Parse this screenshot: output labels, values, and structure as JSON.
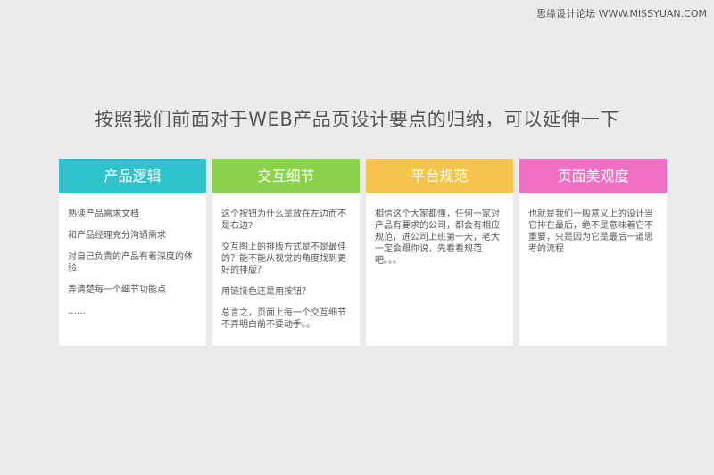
{
  "watermark": "思缘设计论坛 WWW.MISSYUAN.COM",
  "headline": "按照我们前面对于WEB产品页设计要点的归纳，可以延伸一下",
  "cards": [
    {
      "title": "产品逻辑",
      "color": "#2fc3cd",
      "lines": [
        "熟读产品需求文档",
        "和产品经理充分沟通需求",
        "对自己负责的产品有着深度的体验",
        "弄清楚每一个细节功能点",
        "……"
      ]
    },
    {
      "title": "交互细节",
      "color": "#8ad24a",
      "lines": [
        "这个按钮为什么是放在左边而不是右边?",
        "交互图上的排版方式是不是最佳的？能不能从视觉的角度找到更好的排版？",
        "用链接色还是用按钮？",
        "总言之，页面上每一个交互细节不弄明白前不要动手。。"
      ]
    },
    {
      "title": "平台规范",
      "color": "#f5c44c",
      "lines": [
        "相信这个大家都懂，任何一家对产品有要求的公司，都会有相应规范，进公司上班第一天，老大一定会跟你说，先看看规范吧。。。"
      ]
    },
    {
      "title": "页面美观度",
      "color": "#ef6fc3",
      "lines": [
        "也就是我们一般意义上的设计当它排在最后，绝不是意味着它不重要，只是因为它是最后一道思考的流程"
      ]
    }
  ]
}
